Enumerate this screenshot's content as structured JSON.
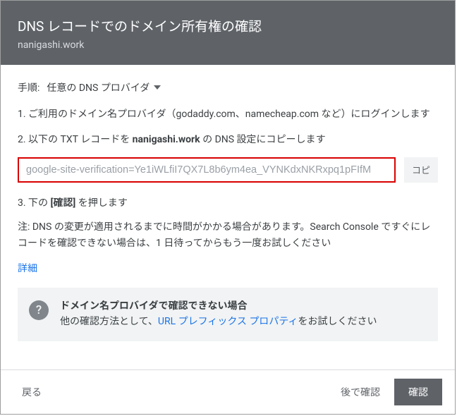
{
  "header": {
    "title": "DNS レコードでのドメイン所有権の確認",
    "subtitle": "nanigashi.work"
  },
  "steps": {
    "label": "手順:",
    "provider": "任意の DNS プロバイダ"
  },
  "instructions": {
    "s1": "1. ご利用のドメイン名プロバイダ（godaddy.com、namecheap.com など）にログインします",
    "s2_pre": "2. 以下の TXT レコードを ",
    "s2_bold": "nanigashi.work",
    "s2_post": " の DNS 設定にコピーします",
    "txt_value": "google-site-verification=Ye1iWLfiI7QX7L8b6ym4ea_VYNKdxNKRxpq1pFIfM",
    "copy_label": "コピ",
    "s3_pre": "3. 下の ",
    "s3_bold": "[確認]",
    "s3_post": " を押します"
  },
  "note": "注: DNS の変更が適用されるまでに時間がかかる場合があります。Search Console ですぐにレコードを確認できない場合は、1 日待ってからもう一度お試しください",
  "details_link": "詳細",
  "info": {
    "title": "ドメイン名プロバイダで確認できない場合",
    "body_pre": "他の確認方法として、",
    "body_link": "URL プレフィックス プロパティ",
    "body_post": "をお試しください"
  },
  "footer": {
    "back": "戻る",
    "later": "後で確認",
    "verify": "確認"
  }
}
